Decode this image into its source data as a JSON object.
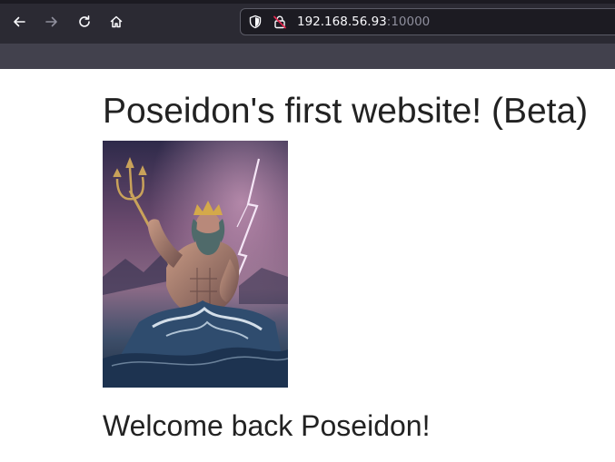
{
  "browser": {
    "url_host": "192.168.56.93",
    "url_port": ":10000",
    "icons": {
      "back": "arrow-left-icon",
      "forward": "arrow-right-icon",
      "reload": "reload-icon",
      "home": "home-icon",
      "tracking_protection": "shield-icon",
      "insecure_connection": "insecure-lock-icon"
    }
  },
  "page": {
    "title": "Poseidon's first website! (Beta)",
    "image_alt": "Poseidon",
    "welcome": "Welcome back Poseidon!"
  },
  "colors": {
    "chrome_bg": "#2b2a33",
    "toolbar_bg": "#42414d",
    "url_bar_bg": "#1c1b22",
    "url_text": "#fbfbfe",
    "url_port_text": "#8f8f9d",
    "page_bg": "#ffffff",
    "page_text": "#222222"
  }
}
